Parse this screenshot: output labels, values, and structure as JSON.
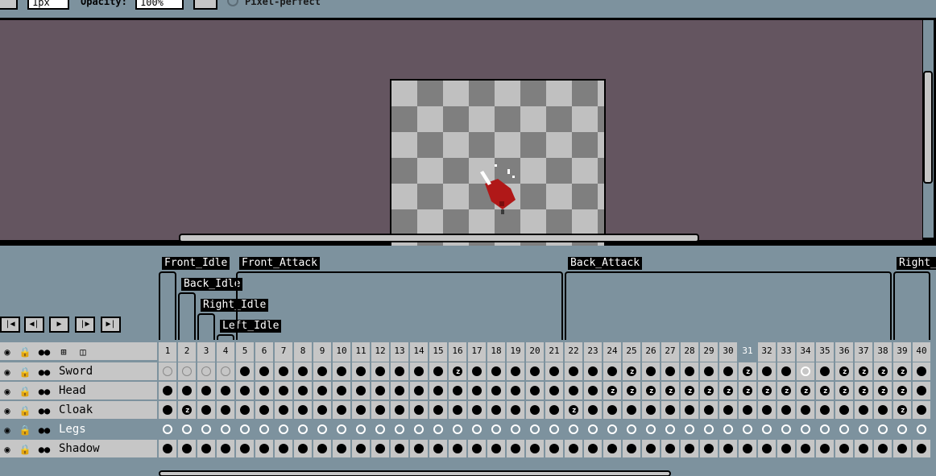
{
  "toolbar": {
    "size_value": "1px",
    "opacity_label": "Opacity:",
    "opacity_value": "100%",
    "pixel_perfect_label": "Pixel-perfect"
  },
  "frame_tags": [
    {
      "name": "Front_Idle",
      "from": 1,
      "to": 1
    },
    {
      "name": "Back_Idle",
      "from": 2,
      "to": 2
    },
    {
      "name": "Right_Idle",
      "from": 3,
      "to": 3
    },
    {
      "name": "Left_Idle",
      "from": 4,
      "to": 4
    },
    {
      "name": "Front_Attack",
      "from": 5,
      "to": 21
    },
    {
      "name": "Back_Attack",
      "from": 22,
      "to": 38
    },
    {
      "name": "Right_",
      "from": 39,
      "to": 40
    }
  ],
  "playback": {
    "first_icon": "first-frame-icon",
    "prev_icon": "previous-frame-icon",
    "play_icon": "play-icon",
    "next_icon": "next-frame-icon",
    "last_icon": "last-frame-icon"
  },
  "frames": [
    "1",
    "2",
    "3",
    "4",
    "5",
    "6",
    "7",
    "8",
    "9",
    "10",
    "11",
    "12",
    "13",
    "14",
    "15",
    "16",
    "17",
    "18",
    "19",
    "20",
    "21",
    "22",
    "23",
    "24",
    "25",
    "26",
    "27",
    "28",
    "29",
    "30",
    "31",
    "32",
    "33",
    "34",
    "35",
    "36",
    "37",
    "38",
    "39",
    "40"
  ],
  "current_frame": 31,
  "layers": [
    {
      "name": "Sword",
      "selected": false,
      "cels": "eeeeffffffffffflfffffffflffffflffcfllllffl"
    },
    {
      "name": "Head",
      "selected": false,
      "cels": "fffffffffffffffffffffffllllllllllllllllffl"
    },
    {
      "name": "Cloak",
      "selected": false,
      "cels": "flffffffffffffffffffflfffffffffffffffflff"
    },
    {
      "name": "Legs",
      "selected": true,
      "cels": "eeeeeeeeeeeeeeeeeeeeeeeeeeeeeeeeeeeeeeee"
    },
    {
      "name": "Shadow",
      "selected": false,
      "cels": "ffffffffffffffffffffffffffffffffffffffff"
    }
  ],
  "colors": {
    "panel": "#7d929e",
    "canvas_bg": "#645560",
    "cell": "#c6c6c6",
    "sprite_red": "#b01818"
  }
}
